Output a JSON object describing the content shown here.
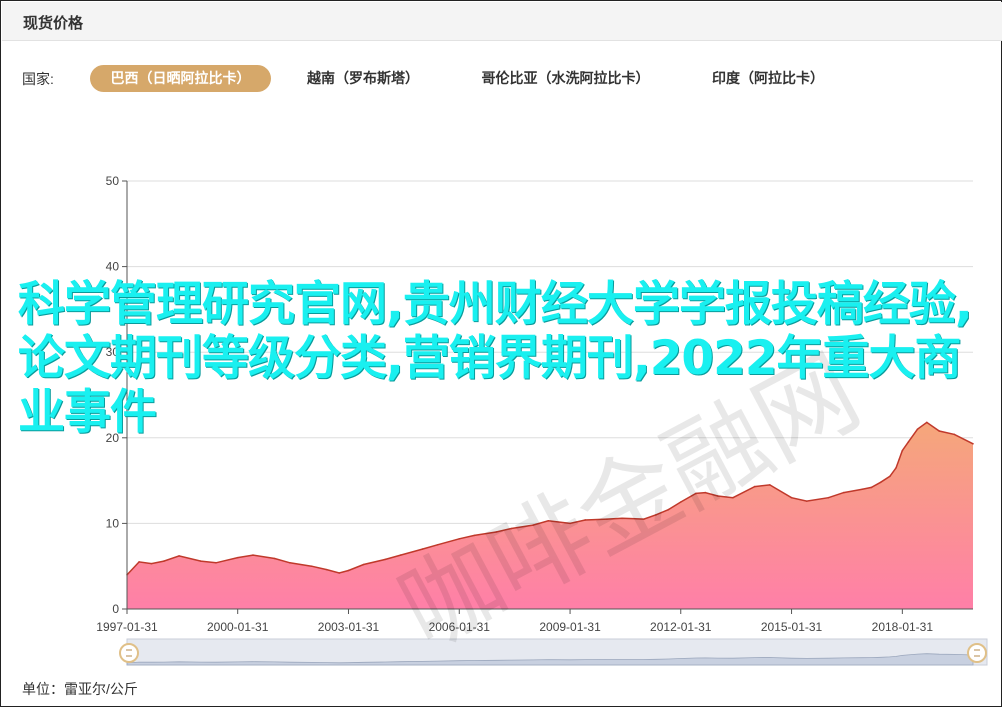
{
  "panel": {
    "title": "现货价格"
  },
  "filter": {
    "label": "国家:",
    "tabs": [
      {
        "label": "巴西（日晒阿拉比卡）",
        "active": true
      },
      {
        "label": "越南（罗布斯塔）",
        "active": false
      },
      {
        "label": "哥伦比亚（水洗阿拉比卡）",
        "active": false
      },
      {
        "label": "印度（阿拉比卡）",
        "active": false
      }
    ]
  },
  "footer": {
    "unit": "单位：雷亚尔/公斤"
  },
  "overlay": {
    "text": "科学管理研究官网,贵州财经大学学报投稿经验,论文期刊等级分类,营销界期刊,2022年重大商业事件"
  },
  "watermark": {
    "text": "咖啡金融网"
  },
  "colors": {
    "line": "#c0392b",
    "area_top": "#f5a77a",
    "area_bottom": "#ff7fa8",
    "active_tab": "#d6a86a",
    "grid": "#dddddd",
    "axis": "#555555"
  },
  "chart_data": {
    "type": "area",
    "title": "",
    "xlabel": "",
    "ylabel": "",
    "ylim": [
      0,
      50
    ],
    "yticks": [
      0,
      10,
      20,
      30,
      40,
      50
    ],
    "xticks": [
      "1997-01-31",
      "2000-01-31",
      "2003-01-31",
      "2006-01-31",
      "2009-01-31",
      "2012-01-31",
      "2015-01-31",
      "2018-01-31"
    ],
    "xrange": [
      "1997-01-31",
      "2019-12-31"
    ],
    "grid": true,
    "legend": "none",
    "series": [
      {
        "x": [
          "1997-01-31",
          "1997-05-31",
          "1997-09-30",
          "1998-01-31",
          "1998-06-30",
          "1999-01-31",
          "1999-06-30",
          "2000-01-31",
          "2000-06-30",
          "2001-01-31",
          "2001-06-30",
          "2002-01-31",
          "2002-06-30",
          "2002-10-31",
          "2003-01-31",
          "2003-06-30",
          "2004-01-31",
          "2004-06-30",
          "2005-01-31",
          "2005-06-30",
          "2006-01-31",
          "2006-06-30",
          "2007-01-31",
          "2007-06-30",
          "2008-01-31",
          "2008-06-30",
          "2009-01-31",
          "2009-06-30",
          "2010-01-31",
          "2010-06-30",
          "2011-01-31",
          "2011-05-31",
          "2011-09-30",
          "2012-01-31",
          "2012-06-30",
          "2012-09-30",
          "2013-01-31",
          "2013-06-30",
          "2014-01-31",
          "2014-06-30",
          "2015-01-31",
          "2015-06-30",
          "2016-01-31",
          "2016-06-30",
          "2016-12-31",
          "2017-03-31",
          "2017-06-30",
          "2017-09-30",
          "2017-11-30",
          "2017-12-31",
          "2018-01-31",
          "2018-03-31",
          "2018-06-30",
          "2018-09-30",
          "2019-01-31",
          "2019-06-30",
          "2019-12-31"
        ],
        "y": [
          4.0,
          5.5,
          5.3,
          5.6,
          6.2,
          5.6,
          5.4,
          6.0,
          6.3,
          5.9,
          5.4,
          5.0,
          4.6,
          4.2,
          4.5,
          5.2,
          5.8,
          6.3,
          7.0,
          7.5,
          8.2,
          8.6,
          9.0,
          9.4,
          9.8,
          10.3,
          10.0,
          10.4,
          10.5,
          10.6,
          10.5,
          11.0,
          11.6,
          12.5,
          13.5,
          13.6,
          13.2,
          13.0,
          14.3,
          14.5,
          13.0,
          12.6,
          13.0,
          13.6,
          14.0,
          14.2,
          14.8,
          15.5,
          16.5,
          17.5,
          18.5,
          19.5,
          21.0,
          21.8,
          20.8,
          20.4,
          19.3
        ]
      }
    ]
  }
}
